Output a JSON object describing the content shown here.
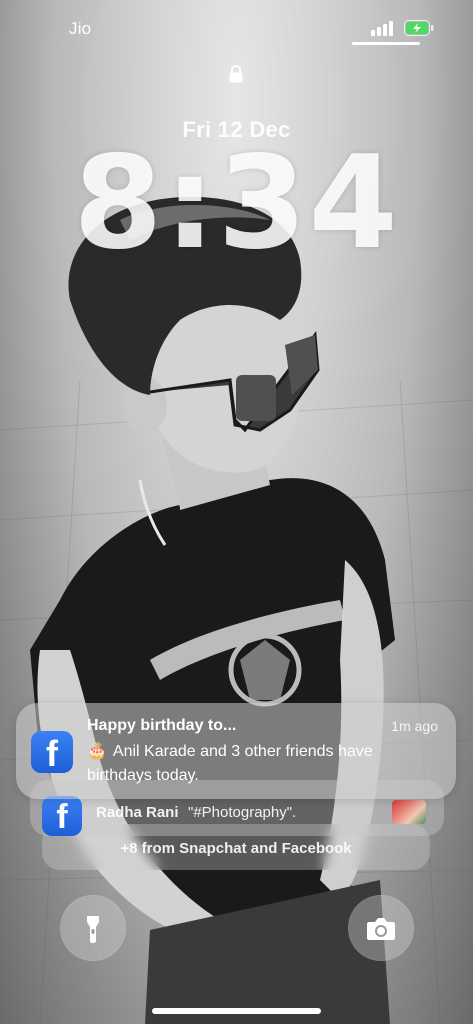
{
  "status_bar": {
    "carrier": "Jio",
    "signal_icon": "cellular-signal-icon",
    "battery_icon": "battery-charging-icon"
  },
  "lock": {
    "icon": "lock-icon"
  },
  "date": "Fri 12 Dec",
  "time": "8:34",
  "notifications": {
    "primary": {
      "app_icon": "facebook-icon",
      "title": "Happy birthday to...",
      "time_ago": "1m ago",
      "emoji": "🎂",
      "body": "Anil Karade and 3 other friends have birthdays today."
    },
    "secondary": {
      "app_icon": "facebook-icon",
      "sender": "Radha Rani",
      "snippet": "\"#Photography\"."
    },
    "more_label": "+8 from Snapchat and Facebook"
  },
  "quick_actions": {
    "flashlight_icon": "flashlight-icon",
    "camera_icon": "camera-icon"
  },
  "colors": {
    "facebook_blue": "#1d5fd6",
    "battery_green": "#4cd964"
  }
}
